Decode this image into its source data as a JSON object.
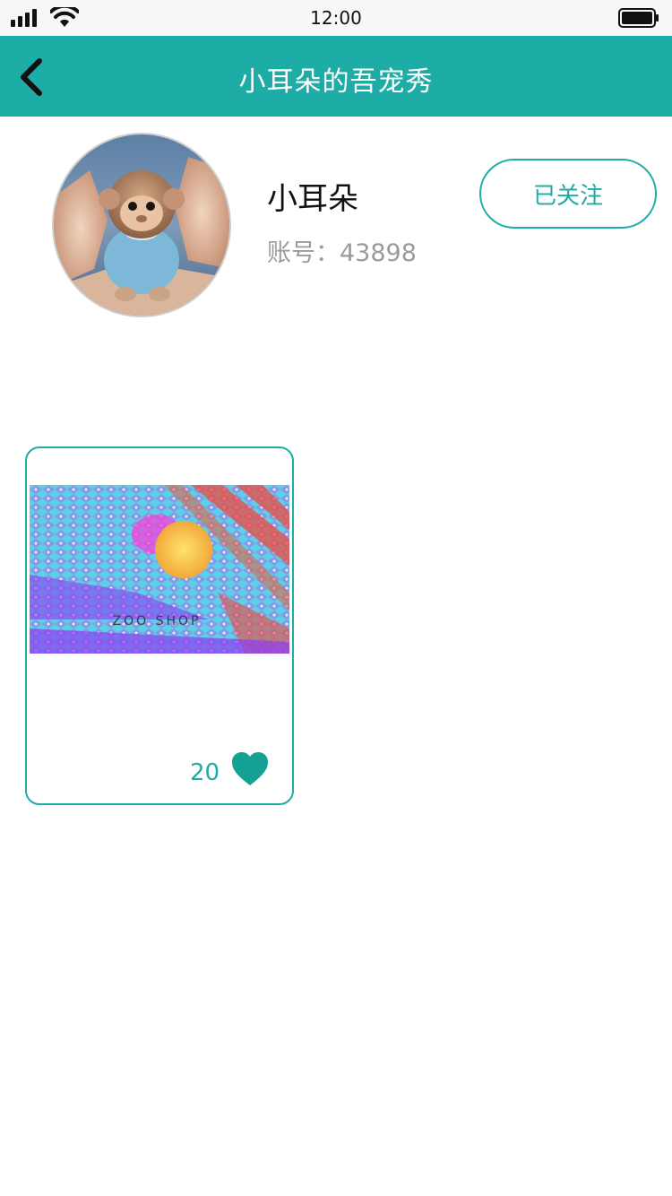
{
  "status_bar": {
    "time": "12:00"
  },
  "nav": {
    "title": "小耳朵的吾宠秀",
    "back_icon": "chevron-left-icon"
  },
  "profile": {
    "name": "小耳朵",
    "account": "账号：43898",
    "follow_label": "已关注"
  },
  "posts": [
    {
      "image_caption": "ZOO SHOP",
      "likes": "20",
      "like_icon": "heart-icon"
    }
  ],
  "colors": {
    "brand": "#1eaca6",
    "secondary_text": "#9b9b9b"
  }
}
